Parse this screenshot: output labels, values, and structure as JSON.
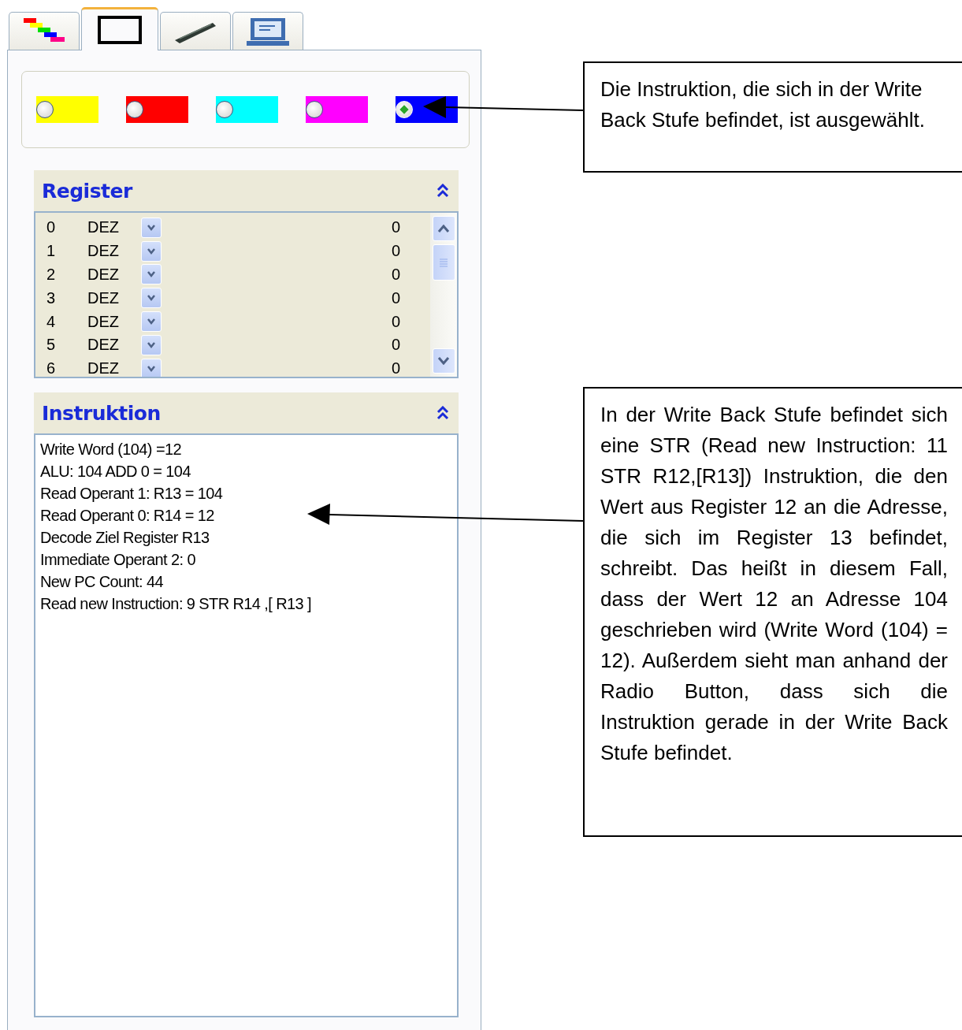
{
  "tabs": [
    {
      "kind": "stages",
      "selected": false
    },
    {
      "kind": "frame",
      "selected": true
    },
    {
      "kind": "chip",
      "selected": false
    },
    {
      "kind": "monitor",
      "selected": false
    }
  ],
  "stages": [
    {
      "color": "#ffff00",
      "selected": false
    },
    {
      "color": "#ff0000",
      "selected": false
    },
    {
      "color": "#00ffff",
      "selected": false
    },
    {
      "color": "#ff00ff",
      "selected": false
    },
    {
      "color": "#0000ff",
      "selected": true
    }
  ],
  "register": {
    "title": "Register",
    "rows": [
      {
        "index": "0",
        "format": "DEZ",
        "value": "0"
      },
      {
        "index": "1",
        "format": "DEZ",
        "value": "0"
      },
      {
        "index": "2",
        "format": "DEZ",
        "value": "0"
      },
      {
        "index": "3",
        "format": "DEZ",
        "value": "0"
      },
      {
        "index": "4",
        "format": "DEZ",
        "value": "0"
      },
      {
        "index": "5",
        "format": "DEZ",
        "value": "0"
      },
      {
        "index": "6",
        "format": "DEZ",
        "value": "0"
      }
    ]
  },
  "instruction": {
    "title": "Instruktion",
    "lines": [
      "Write Word (104) =12",
      "ALU: 104 ADD 0 = 104",
      "Read Operant 1: R13 = 104",
      "Read Operant 0: R14 = 12",
      "Decode Ziel Register R13",
      "Immediate Operant 2: 0",
      "New PC Count: 44",
      "Read new Instruction: 9 STR R14 ,[ R13 ]"
    ]
  },
  "callouts": [
    {
      "text": "Die Instruktion, die sich in der Write Back Stufe befindet, ist ausgewählt.",
      "justified": false
    },
    {
      "text": "In der Write Back Stufe befindet sich eine STR (Read new Instruction: 11 STR R12,[R13]) Instruktion, die den Wert aus Register 12 an die Adresse, die sich im Register 13 befindet, schreibt. Das heißt in diesem Fall, dass der Wert 12 an Adresse 104 geschrieben wird (Write Word (104) = 12). Außerdem sieht man anhand der Radio Button, dass sich die Instruktion gerade in der Write Back Stufe befindet.",
      "justified": true
    }
  ]
}
